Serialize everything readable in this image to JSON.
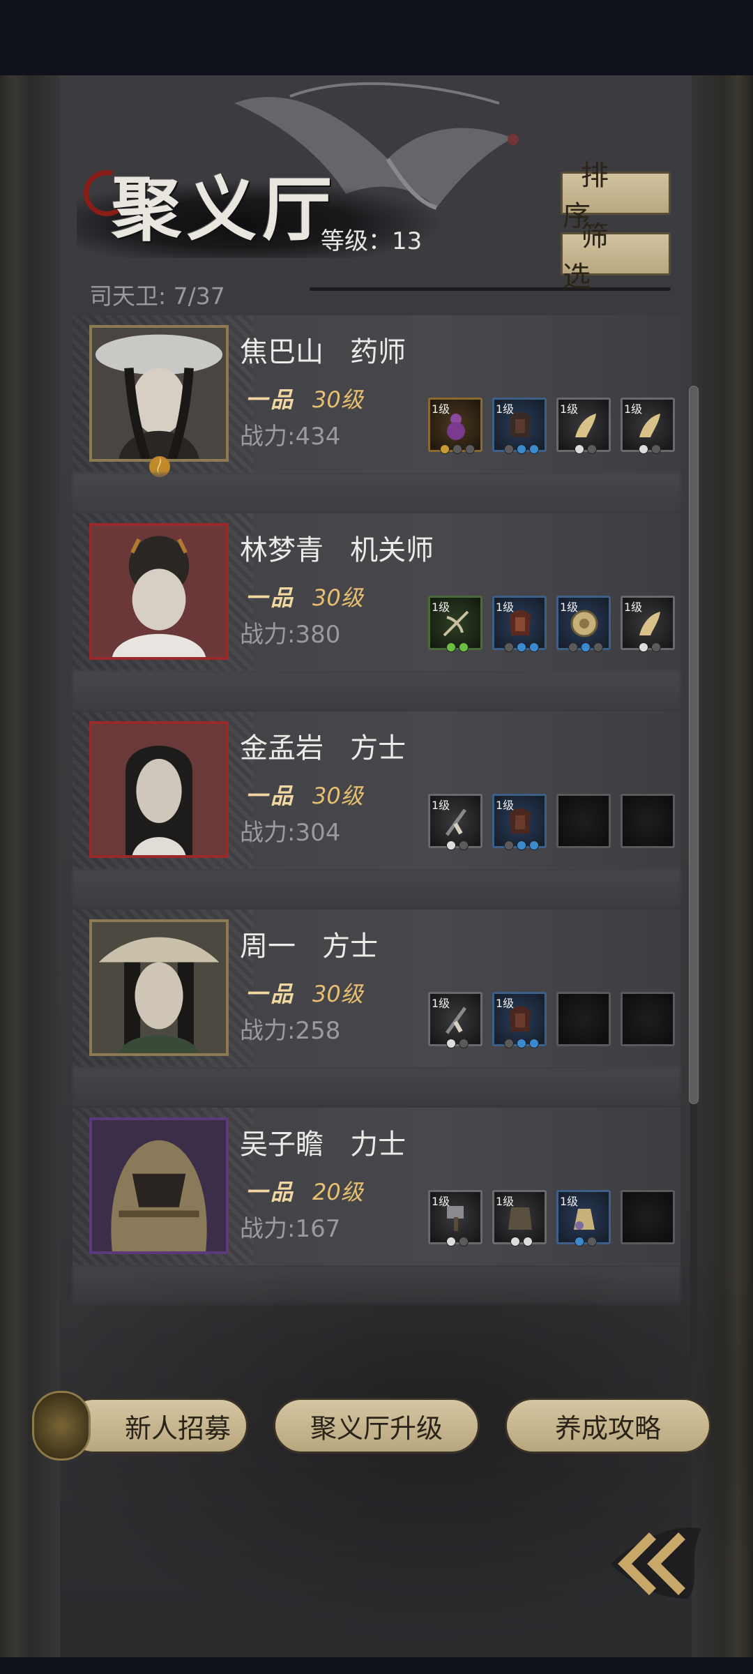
{
  "title": "聚义厅",
  "level_label": "等级：",
  "level_value": "13",
  "guard_count": "司天卫: 7/37",
  "buttons": {
    "sort": "排序",
    "filter": "筛选"
  },
  "heroes": [
    {
      "name": "焦巴山",
      "role": "药师",
      "rank": "一品",
      "level": "30级",
      "power_label": "战力:",
      "power": "434",
      "frame": "#8e7a52",
      "bg": "#4a4540",
      "equipment": [
        {
          "lv": "1级",
          "icon": "gourd-icon",
          "style": "brown"
        },
        {
          "lv": "1级",
          "icon": "armor-icon",
          "style": "blue"
        },
        {
          "lv": "1级",
          "icon": "boot-icon",
          "style": "grey"
        },
        {
          "lv": "1级",
          "icon": "boot-icon",
          "style": "grey"
        }
      ]
    },
    {
      "name": "林梦青",
      "role": "机关师",
      "rank": "一品",
      "level": "30级",
      "power_label": "战力:",
      "power": "380",
      "frame": "#9a2a2a",
      "bg": "#6a3838",
      "equipment": [
        {
          "lv": "1级",
          "icon": "crossbow-icon",
          "style": "green"
        },
        {
          "lv": "1级",
          "icon": "armor-icon",
          "style": "blue"
        },
        {
          "lv": "1级",
          "icon": "disc-icon",
          "style": "blue"
        },
        {
          "lv": "1级",
          "icon": "boot-icon",
          "style": "grey"
        }
      ]
    },
    {
      "name": "金孟岩",
      "role": "方士",
      "rank": "一品",
      "level": "30级",
      "power_label": "战力:",
      "power": "304",
      "frame": "#9a2a2a",
      "bg": "#6a3a3a",
      "equipment": [
        {
          "lv": "1级",
          "icon": "staff-icon",
          "style": "grey"
        },
        {
          "lv": "1级",
          "icon": "armor-icon",
          "style": "blue"
        },
        {
          "lv": "",
          "icon": "empty-slot",
          "style": "empty"
        },
        {
          "lv": "",
          "icon": "empty-slot",
          "style": "empty"
        }
      ]
    },
    {
      "name": "周一",
      "role": "方士",
      "rank": "一品",
      "level": "30级",
      "power_label": "战力:",
      "power": "258",
      "frame": "#8e7a52",
      "bg": "#4c4a40",
      "equipment": [
        {
          "lv": "1级",
          "icon": "staff-icon",
          "style": "grey"
        },
        {
          "lv": "1级",
          "icon": "armor-icon",
          "style": "blue"
        },
        {
          "lv": "",
          "icon": "empty-slot",
          "style": "empty"
        },
        {
          "lv": "",
          "icon": "empty-slot",
          "style": "empty"
        }
      ]
    },
    {
      "name": "吴子瞻",
      "role": "力士",
      "rank": "一品",
      "level": "20级",
      "power_label": "战力:",
      "power": "167",
      "frame": "#5a3a7a",
      "bg": "#3a2e48",
      "equipment": [
        {
          "lv": "1级",
          "icon": "hammer-icon",
          "style": "grey"
        },
        {
          "lv": "1级",
          "icon": "robe-icon",
          "style": "grey"
        },
        {
          "lv": "1级",
          "icon": "pouch-icon",
          "style": "blue"
        },
        {
          "lv": "",
          "icon": "empty-slot",
          "style": "empty"
        }
      ]
    }
  ],
  "bottom": {
    "recruit": "新人招募",
    "upgrade": "聚义厅升级",
    "guide": "养成攻略"
  },
  "icons": {
    "back": "double-chevron-left-icon",
    "recruit": "seal-token-icon"
  }
}
